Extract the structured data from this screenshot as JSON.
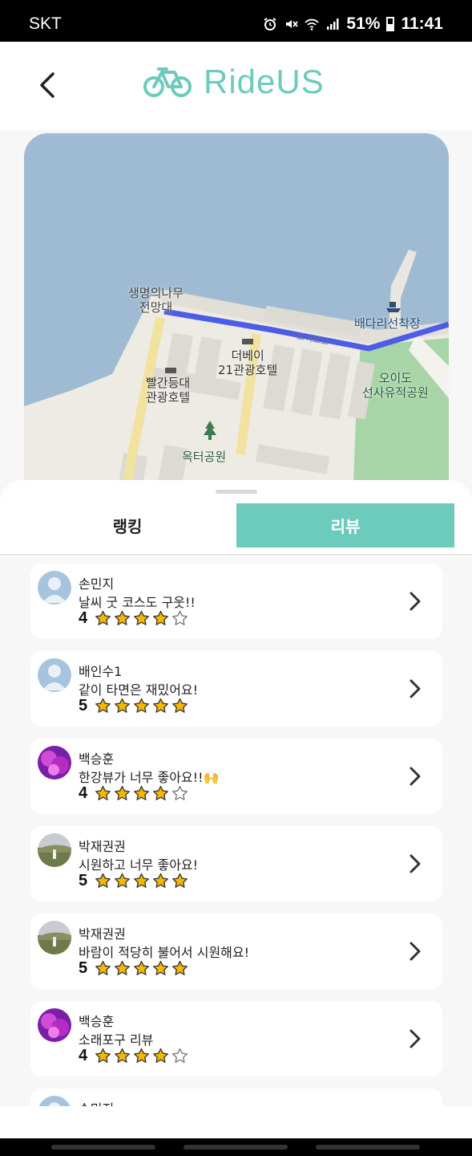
{
  "status_bar": {
    "carrier": "SKT",
    "battery": "51%",
    "time": "11:41"
  },
  "header": {
    "app_name": "RideUS"
  },
  "map": {
    "labels": {
      "tree_observatory": [
        "생명의나무",
        "전망대"
      ],
      "baedari_pier": "배다리선착장",
      "the_bay_hotel": [
        "더베이",
        "21관광호텔"
      ],
      "lighthouse_hotel": [
        "빨간등대",
        "관광호텔"
      ],
      "oido_park": [
        "오이도",
        "선사유적공원"
      ],
      "oktuh_park": "옥터공원",
      "road": "오이도로"
    },
    "route_color": "#4b5ce6"
  },
  "tabs": {
    "ranking": "랭킹",
    "review": "리뷰",
    "active": "review"
  },
  "reviews": [
    {
      "name": "손민지",
      "comment": "날씨 굿 코스도 구웃!!",
      "rating": "4",
      "stars": 4,
      "avatar": "default"
    },
    {
      "name": "배인수1",
      "comment": "같이 타면은 재밌어요!",
      "rating": "5",
      "stars": 5,
      "avatar": "default"
    },
    {
      "name": "백승훈",
      "comment": "한강뷰가 너무 좋아요!!🙌",
      "rating": "4",
      "stars": 4,
      "avatar": "purple"
    },
    {
      "name": "박재권권",
      "comment": "시원하고 너무 좋아요!",
      "rating": "5",
      "stars": 5,
      "avatar": "landscape"
    },
    {
      "name": "박재권권",
      "comment": "바람이 적당히 불어서 시원해요!",
      "rating": "5",
      "stars": 5,
      "avatar": "landscape"
    },
    {
      "name": "백승훈",
      "comment": "소래포구 리뷰",
      "rating": "4",
      "stars": 4,
      "avatar": "purple"
    },
    {
      "name": "손민지",
      "comment": "",
      "rating": "",
      "stars": 0,
      "avatar": "default"
    }
  ],
  "colors": {
    "accent": "#6ccbbd",
    "star_fill": "#f5b800",
    "route": "#4b5ce6"
  },
  "icons": {
    "back": "chevron-left-icon",
    "logo": "bicycle-icon",
    "row_action": "chevron-right-icon",
    "rating": "star-icon"
  }
}
